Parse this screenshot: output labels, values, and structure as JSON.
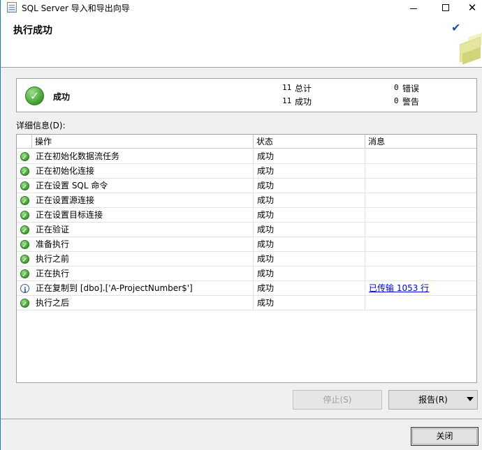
{
  "window": {
    "title": "SQL Server 导入和导出向导",
    "controls": {
      "minimize": "─",
      "maximize": "☐",
      "close": "✕"
    }
  },
  "header": {
    "title": "执行成功",
    "check": "✔"
  },
  "summary": {
    "status": "成功",
    "total_count": "11",
    "total_label": "总计",
    "success_count": "11",
    "success_label": "成功",
    "error_count": "0",
    "error_label": "错误",
    "warning_count": "0",
    "warning_label": "警告"
  },
  "details": {
    "label": "详细信息(D):",
    "columns": [
      "操作",
      "状态",
      "消息"
    ],
    "rows": [
      {
        "icon": "success-icon",
        "action": "正在初始化数据流任务",
        "status": "成功",
        "message": ""
      },
      {
        "icon": "success-icon",
        "action": "正在初始化连接",
        "status": "成功",
        "message": ""
      },
      {
        "icon": "success-icon",
        "action": "正在设置 SQL 命令",
        "status": "成功",
        "message": ""
      },
      {
        "icon": "success-icon",
        "action": "正在设置源连接",
        "status": "成功",
        "message": ""
      },
      {
        "icon": "success-icon",
        "action": "正在设置目标连接",
        "status": "成功",
        "message": ""
      },
      {
        "icon": "success-icon",
        "action": "正在验证",
        "status": "成功",
        "message": ""
      },
      {
        "icon": "success-icon",
        "action": "准备执行",
        "status": "成功",
        "message": ""
      },
      {
        "icon": "success-icon",
        "action": "执行之前",
        "status": "成功",
        "message": ""
      },
      {
        "icon": "success-icon",
        "action": "正在执行",
        "status": "成功",
        "message": ""
      },
      {
        "icon": "info-icon",
        "action": "正在复制到 [dbo].['A-ProjectNumber$']",
        "status": "成功",
        "message": "已传输 1053 行"
      },
      {
        "icon": "success-icon",
        "action": "执行之后",
        "status": "成功",
        "message": ""
      }
    ]
  },
  "buttons": {
    "stop": "停止(S)",
    "report": "报告(R)",
    "close": "关闭"
  },
  "colors": {
    "success_green": "#3d9e2c",
    "link_blue": "#0000ee",
    "check_blue": "#1f4fb0"
  }
}
